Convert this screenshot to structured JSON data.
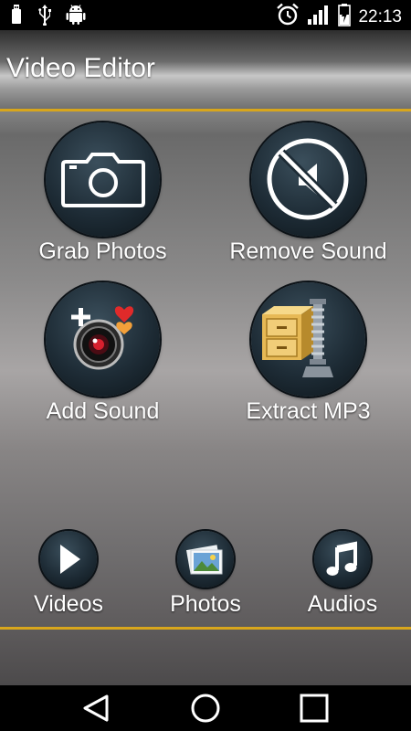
{
  "status_bar": {
    "time": "22:13",
    "left_icons": [
      "usb-icon",
      "usb-trident-icon",
      "android-icon"
    ],
    "right_icons": [
      "alarm-icon",
      "signal-icon",
      "battery-charging-icon"
    ]
  },
  "app": {
    "title": "Video Editor",
    "accent_color": "#d8a61c"
  },
  "tiles": [
    {
      "label": "Grab Photos",
      "icon": "camera-icon"
    },
    {
      "label": "Remove Sound",
      "icon": "mute-icon"
    },
    {
      "label": "Add Sound",
      "icon": "camera-lens-hearts-icon"
    },
    {
      "label": "Extract MP3",
      "icon": "cabinet-zip-icon"
    }
  ],
  "bottom_nav": [
    {
      "label": "Videos",
      "icon": "play-icon"
    },
    {
      "label": "Photos",
      "icon": "photos-icon"
    },
    {
      "label": "Audios",
      "icon": "music-note-icon"
    }
  ],
  "system_nav": [
    "back-icon",
    "home-icon",
    "recents-icon"
  ]
}
